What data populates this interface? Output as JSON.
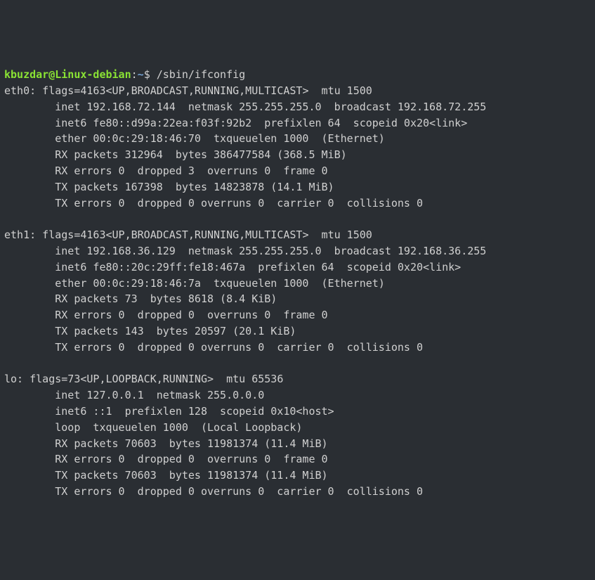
{
  "prompt": {
    "user": "kbuzdar",
    "at": "@",
    "host": "Linux-debian",
    "colon": ":",
    "path": "~",
    "symbol": "$",
    "command": "/sbin/ifconfig"
  },
  "interfaces": [
    {
      "name": "eth0",
      "flags_line": "eth0: flags=4163<UP,BROADCAST,RUNNING,MULTICAST>  mtu 1500",
      "lines": [
        "inet 192.168.72.144  netmask 255.255.255.0  broadcast 192.168.72.255",
        "inet6 fe80::d99a:22ea:f03f:92b2  prefixlen 64  scopeid 0x20<link>",
        "ether 00:0c:29:18:46:70  txqueuelen 1000  (Ethernet)",
        "RX packets 312964  bytes 386477584 (368.5 MiB)",
        "RX errors 0  dropped 3  overruns 0  frame 0",
        "TX packets 167398  bytes 14823878 (14.1 MiB)",
        "TX errors 0  dropped 0 overruns 0  carrier 0  collisions 0"
      ]
    },
    {
      "name": "eth1",
      "flags_line": "eth1: flags=4163<UP,BROADCAST,RUNNING,MULTICAST>  mtu 1500",
      "lines": [
        "inet 192.168.36.129  netmask 255.255.255.0  broadcast 192.168.36.255",
        "inet6 fe80::20c:29ff:fe18:467a  prefixlen 64  scopeid 0x20<link>",
        "ether 00:0c:29:18:46:7a  txqueuelen 1000  (Ethernet)",
        "RX packets 73  bytes 8618 (8.4 KiB)",
        "RX errors 0  dropped 0  overruns 0  frame 0",
        "TX packets 143  bytes 20597 (20.1 KiB)",
        "TX errors 0  dropped 0 overruns 0  carrier 0  collisions 0"
      ]
    },
    {
      "name": "lo",
      "flags_line": "lo: flags=73<UP,LOOPBACK,RUNNING>  mtu 65536",
      "lines": [
        "inet 127.0.0.1  netmask 255.0.0.0",
        "inet6 ::1  prefixlen 128  scopeid 0x10<host>",
        "loop  txqueuelen 1000  (Local Loopback)",
        "RX packets 70603  bytes 11981374 (11.4 MiB)",
        "RX errors 0  dropped 0  overruns 0  frame 0",
        "TX packets 70603  bytes 11981374 (11.4 MiB)",
        "TX errors 0  dropped 0 overruns 0  carrier 0  collisions 0"
      ]
    }
  ]
}
